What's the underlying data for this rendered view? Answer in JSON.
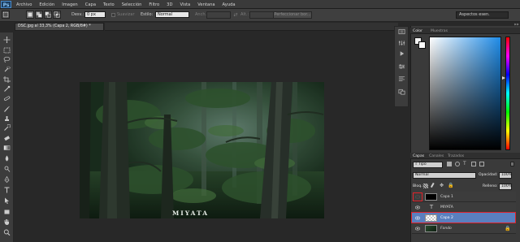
{
  "app": {
    "logo": "Ps"
  },
  "menu": [
    "Archivo",
    "Edición",
    "Imagen",
    "Capa",
    "Texto",
    "Selección",
    "Filtro",
    "3D",
    "Vista",
    "Ventana",
    "Ayuda"
  ],
  "options_bar": {
    "feather_label": "Desv.:",
    "feather_value": "0 px",
    "antialias_label": "Suavizar",
    "style_label": "Estilo:",
    "style_value": "Normal",
    "width_label": "Anch.:",
    "height_label": "Alt.:",
    "refine_button": "Perfeccionar bor...",
    "workspace": "Aspectos esen."
  },
  "document": {
    "tab_title": "DSC.jpg al 33,3% (Capa 2, RGB/8#) *",
    "watermark_text": "MIYATA"
  },
  "color_panel": {
    "tabs": [
      "Color",
      "Muestras"
    ]
  },
  "layers_panel": {
    "tabs": [
      "Capas",
      "Canales",
      "Trazados"
    ],
    "filter_kind": "Tipo",
    "blend_mode": "Normal",
    "opacity_label": "Opacidad:",
    "opacity_value": "100%",
    "lock_label": "Bloq.:",
    "fill_label": "Relleno:",
    "fill_value": "100%",
    "layers": [
      {
        "name": "Capa 1",
        "type": "fill",
        "highlighted_eye": true
      },
      {
        "name": "MIYATA",
        "type": "text"
      },
      {
        "name": "Capa 2",
        "type": "transparent",
        "selected": true
      },
      {
        "name": "Fondo",
        "type": "image",
        "locked": true
      }
    ]
  },
  "colors": {
    "accent": "#5a7fbf",
    "highlight": "#e0222a"
  }
}
